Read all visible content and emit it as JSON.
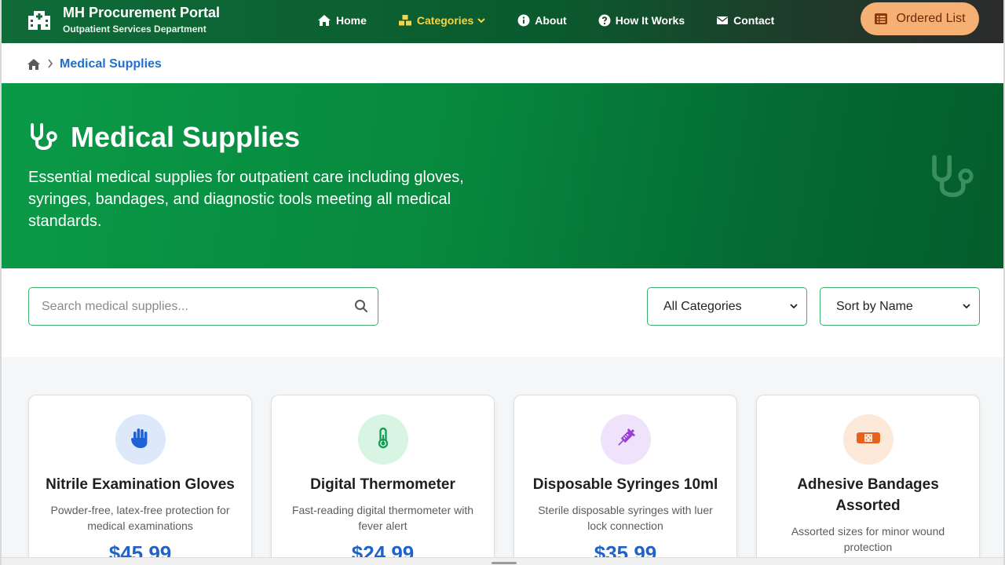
{
  "brand": {
    "title": "MH Procurement Portal",
    "subtitle": "Outpatient Services Department",
    "icon": "hospital-icon"
  },
  "nav": {
    "items": [
      {
        "label": "Home",
        "icon": "home-icon"
      },
      {
        "label": "Categories",
        "icon": "boxes-icon",
        "active": true
      },
      {
        "label": "About",
        "icon": "info-icon"
      },
      {
        "label": "How It Works",
        "icon": "question-icon"
      },
      {
        "label": "Contact",
        "icon": "envelope-icon"
      }
    ],
    "ordered_list_label": "Ordered List"
  },
  "breadcrumb": {
    "current": "Medical Supplies"
  },
  "hero": {
    "title": "Medical Supplies",
    "description": "Essential medical supplies for outpatient care including gloves, syringes, bandages, and diagnostic tools meeting all medical standards."
  },
  "filters": {
    "search_placeholder": "Search medical supplies...",
    "category_selected": "All Categories",
    "sort_selected": "Sort by Name"
  },
  "products": [
    {
      "name": "Nitrile Examination Gloves",
      "description": "Powder-free, latex-free protection for medical examinations",
      "price": "$45.99",
      "icon": "hand-icon",
      "icon_color": "#1e62d6",
      "circle_color": "#dde9fb"
    },
    {
      "name": "Digital Thermometer",
      "description": "Fast-reading digital thermometer with fever alert",
      "price": "$24.99",
      "icon": "thermometer-icon",
      "icon_color": "#13a055",
      "circle_color": "#d8f5e4"
    },
    {
      "name": "Disposable Syringes 10ml",
      "description": "Sterile disposable syringes with luer lock connection",
      "price": "$35.99",
      "icon": "syringe-icon",
      "icon_color": "#9b3fd6",
      "circle_color": "#efe3fb"
    },
    {
      "name": "Adhesive Bandages Assorted",
      "description": "Assorted sizes for minor wound protection",
      "price": "",
      "icon": "bandage-icon",
      "icon_color": "#e8621a",
      "circle_color": "#fde9d9"
    }
  ],
  "colors": {
    "primary_green": "#08883e",
    "accent_orange": "#f6b073",
    "price_blue": "#1f63c9",
    "breadcrumb_blue": "#1f6fd1"
  }
}
